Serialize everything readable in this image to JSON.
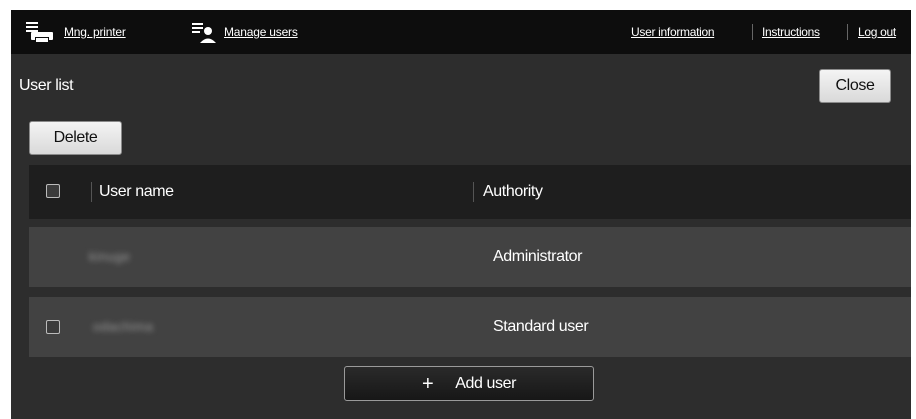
{
  "nav": {
    "mng_printer": {
      "label": "Mng. printer",
      "icon": "printer-icon"
    },
    "manage_users": {
      "label": "Manage users",
      "icon": "manage-users-icon"
    },
    "user_information": "User information",
    "instructions": "Instructions",
    "log_out": "Log out"
  },
  "page": {
    "title": "User list",
    "close_label": "Close",
    "delete_label": "Delete",
    "add_user_label": "Add user",
    "add_user_icon": "plus-icon"
  },
  "table": {
    "headers": [
      "User name",
      "Authority"
    ],
    "rows": [
      {
        "user_name": "kinuge",
        "authority": "Administrator",
        "has_checkbox": false
      },
      {
        "user_name": "odachima",
        "authority": "Standard user",
        "has_checkbox": true
      }
    ]
  },
  "colors": {
    "background": "#2d2d2d",
    "topbar": "#0d0d0d",
    "table_header": "#1e1e1e",
    "table_row": "#424242"
  }
}
